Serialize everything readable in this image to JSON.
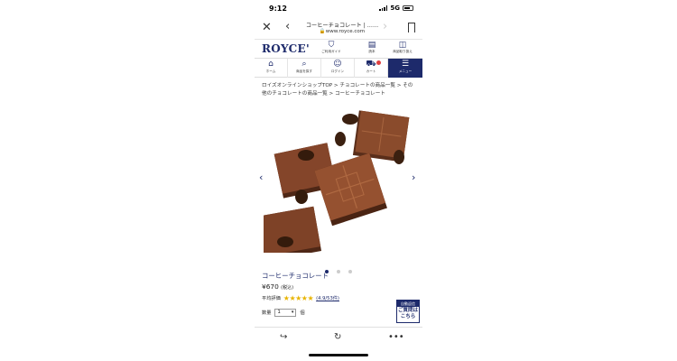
{
  "status_bar": {
    "time": "9:12",
    "network": "5G"
  },
  "browser": {
    "page_title": "コーヒーチョコレート | ……",
    "url": "www.royce.com"
  },
  "header": {
    "logo": "ROYCE'",
    "icons": [
      {
        "label": "ご利用ガイド",
        "icon": "shield-icon"
      },
      {
        "label": "読本",
        "icon": "book-icon"
      },
      {
        "label": "商品取り扱え",
        "icon": "open-book-icon"
      }
    ]
  },
  "nav": [
    {
      "label": "ホーム",
      "icon": "home-icon"
    },
    {
      "label": "商品を探す",
      "icon": "search-icon"
    },
    {
      "label": "ログイン",
      "icon": "user-icon"
    },
    {
      "label": "カート",
      "icon": "cart-icon"
    },
    {
      "label": "メニュー",
      "icon": "hamburger-icon"
    }
  ],
  "breadcrumb": "ロイズオンラインショップTOP > チョコレートの商品一覧 > その他のチョコレートの商品一覧 > コーヒーチョコレート",
  "carousel": {
    "total": 3,
    "active": 1
  },
  "product": {
    "name": "コーヒーチョコレート",
    "price": "¥670",
    "tax_note": "(税込)",
    "rating_label": "平均評価",
    "rating_value": 5,
    "rating_count": "(4.9/53件)",
    "qty_label": "数量",
    "qty_value": "1",
    "qty_unit": "個"
  },
  "autoship": {
    "line1": "自動返信",
    "line2": "ご質問は",
    "line3": "こちら"
  },
  "colors": {
    "brand": "#1d2a6b",
    "star": "#e8b400"
  }
}
